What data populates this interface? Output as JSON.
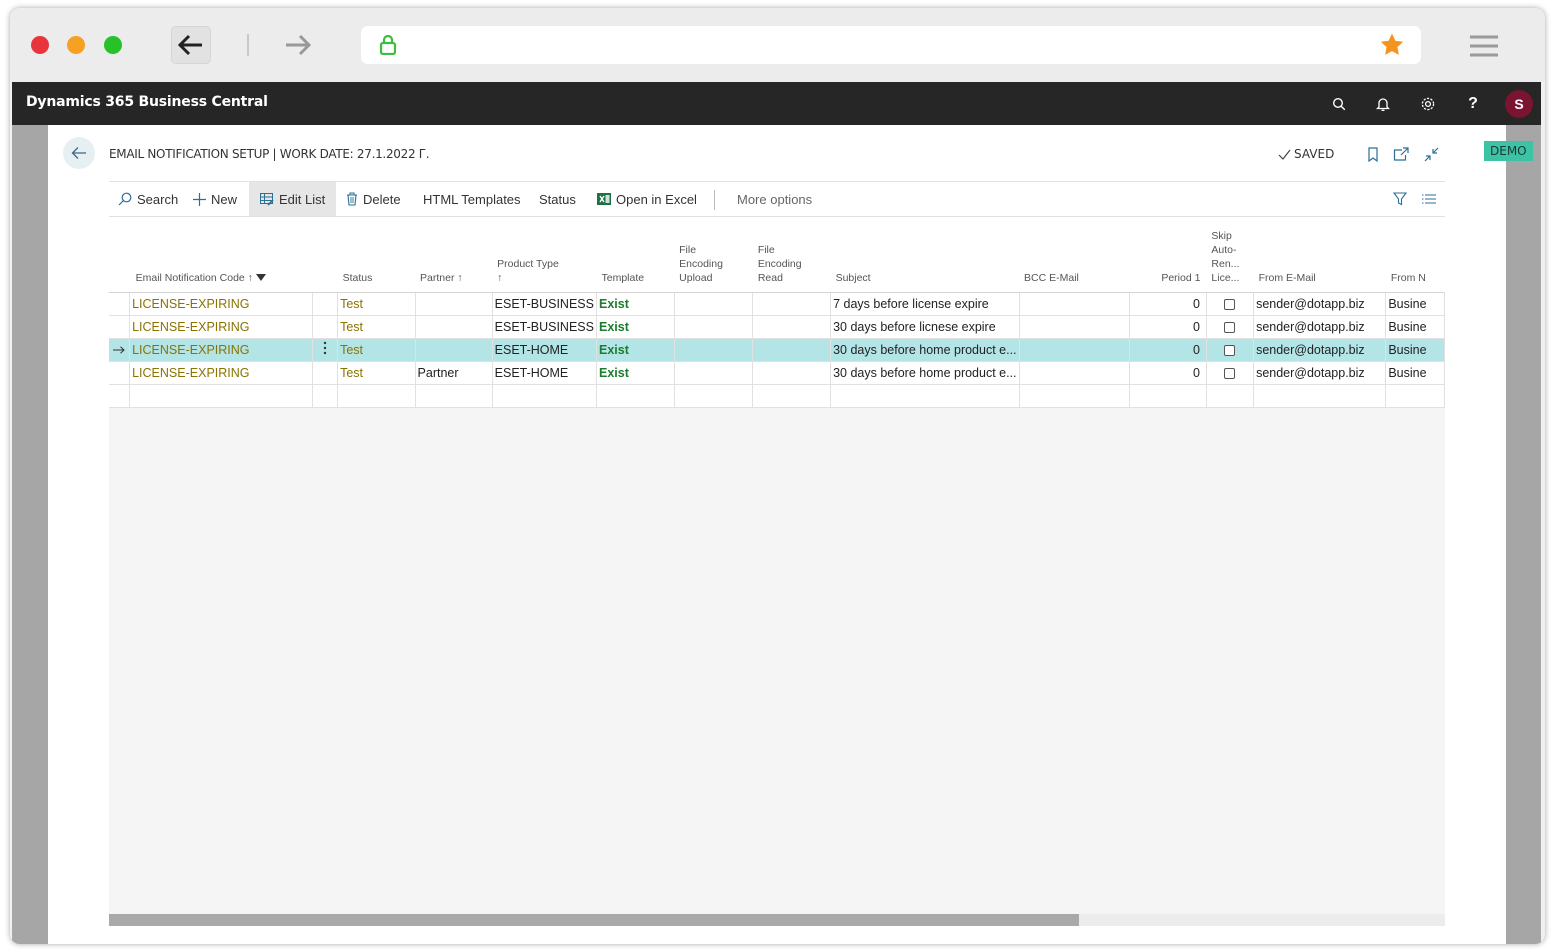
{
  "app": {
    "title": "Dynamics 365 Business Central",
    "user_initial": "S",
    "environment_badge": "DEMO"
  },
  "page": {
    "title": "EMAIL NOTIFICATION SETUP | WORK DATE: 27.1.2022 Г.",
    "saved_label": "SAVED"
  },
  "actions": {
    "search": "Search",
    "new": "New",
    "edit_list": "Edit List",
    "delete": "Delete",
    "html_templates": "HTML Templates",
    "status": "Status",
    "open_in_excel": "Open in Excel",
    "more_options": "More options"
  },
  "columns": {
    "code": "Email Notification Code ↑",
    "status": "Status",
    "partner": "Partner ↑",
    "product_type_1": "Product Type",
    "product_type_2": "↑",
    "template": "Template",
    "fe_upload_1": "File",
    "fe_upload_2": "Encoding",
    "fe_upload_3": "Upload",
    "fe_read_1": "File",
    "fe_read_2": "Encoding",
    "fe_read_3": "Read",
    "subject": "Subject",
    "bcc": "BCC E-Mail",
    "period": "Period 1",
    "skip_1": "Skip",
    "skip_2": "Auto-",
    "skip_3": "Ren...",
    "skip_4": "Lice...",
    "from_email": "From E-Mail",
    "from_name": "From N"
  },
  "rows": [
    {
      "code": "LICENSE-EXPIRING",
      "status": "Test",
      "partner": "",
      "product_type": "ESET-BUSINESS",
      "template": "Exist",
      "subject": "7 days before license expire",
      "bcc": "",
      "period": "0",
      "skip": false,
      "from_email": "sender@dotapp.biz",
      "from_name": "Busine"
    },
    {
      "code": "LICENSE-EXPIRING",
      "status": "Test",
      "partner": "",
      "product_type": "ESET-BUSINESS",
      "template": "Exist",
      "subject": "30 days before licnese expire",
      "bcc": "",
      "period": "0",
      "skip": false,
      "from_email": "sender@dotapp.biz",
      "from_name": "Busine"
    },
    {
      "code": "LICENSE-EXPIRING",
      "status": "Test",
      "partner": "",
      "product_type": "ESET-HOME",
      "template": "Exist",
      "subject": "30 days before home product e...",
      "bcc": "",
      "period": "0",
      "skip": false,
      "from_email": "sender@dotapp.biz",
      "from_name": "Busine"
    },
    {
      "code": "LICENSE-EXPIRING",
      "status": "Test",
      "partner": "Partner",
      "product_type": "ESET-HOME",
      "template": "Exist",
      "subject": "30 days before home product e...",
      "bcc": "",
      "period": "0",
      "skip": false,
      "from_email": "sender@dotapp.biz",
      "from_name": "Busine"
    }
  ],
  "colors": {
    "header_bg": "#262626",
    "selected_row": "#b3e5e6",
    "code_text": "#8a7300",
    "exist_text": "#1d7d2e",
    "avatar_bg": "#7a1430",
    "demo_badge": "#3cc3a5"
  }
}
